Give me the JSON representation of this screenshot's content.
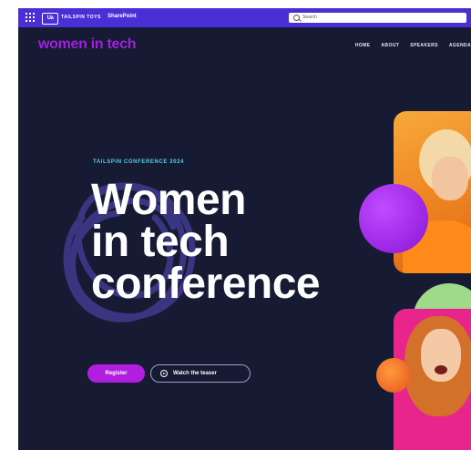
{
  "suite_bar": {
    "org_logo": "Ua",
    "org_name": "TAILSPIN TOYS",
    "app_name": "SharePoint",
    "search_placeholder": "Search",
    "accent": "#4a2fd6"
  },
  "site": {
    "logo": "women in tech",
    "logo_color": "#a020e0",
    "nav": [
      "HOME",
      "ABOUT",
      "SPEAKERS",
      "AGENDA"
    ]
  },
  "hero": {
    "eyebrow": "TAILSPIN CONFERENCE 2024",
    "headline": [
      "Women",
      "in tech",
      "conference"
    ],
    "background": "#161a33",
    "register_label": "Register",
    "teaser_label": "Watch the teaser"
  },
  "icons": [
    "app-launcher-icon",
    "search-icon",
    "play-icon"
  ]
}
